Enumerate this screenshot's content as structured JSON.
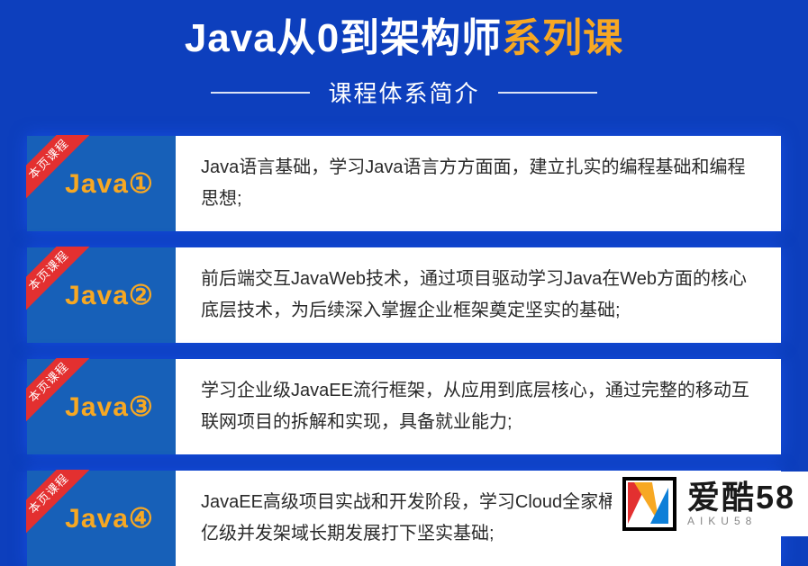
{
  "header": {
    "title_white": "Java从0到架构师",
    "title_orange": "系列课",
    "subtitle": "课程体系简介"
  },
  "ribbon_label": "本页课程",
  "stages": [
    {
      "label": "Java①",
      "desc": "Java语言基础，学习Java语言方方面面，建立扎实的编程基础和编程思想;"
    },
    {
      "label": "Java②",
      "desc": "前后端交互JavaWeb技术，通过项目驱动学习Java在Web方面的核心底层技术，为后续深入掌握企业框架奠定坚实的基础;"
    },
    {
      "label": "Java③",
      "desc": "学习企业级JavaEE流行框架，从应用到底层核心，通过完整的移动互联网项目的拆解和实现，具备就业能力;"
    },
    {
      "label": "Java④",
      "desc": "JavaEE高级项目实战和开发阶段，学习Cloud全家桶，分布式架构，亿级并发架域长期发展打下坚实基础;"
    }
  ],
  "watermark": {
    "main": "爱酷58",
    "sub": "AIKU58"
  }
}
